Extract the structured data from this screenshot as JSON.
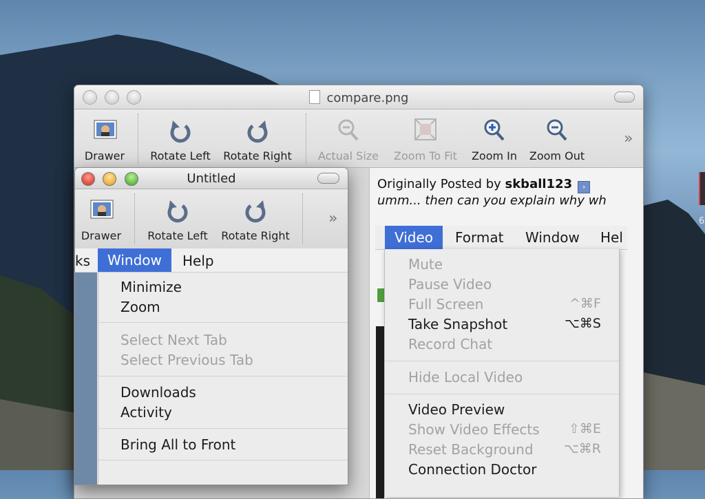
{
  "back_window": {
    "title": "compare.png",
    "toolbar": {
      "drawer": "Drawer",
      "rotate_left": "Rotate Left",
      "rotate_right": "Rotate Right",
      "actual_size": "Actual Size",
      "zoom_to_fit": "Zoom To Fit",
      "zoom_in": "Zoom In",
      "zoom_out": "Zoom Out",
      "overflow": "»"
    },
    "post": {
      "prefix": "Originally Posted by ",
      "author": "skball123",
      "text": "umm... then can you explain why wh"
    },
    "menubar": [
      "Video",
      "Format",
      "Window",
      "Hel"
    ],
    "video_menu": [
      {
        "label": "Mute",
        "shortcut": "",
        "disabled": true
      },
      {
        "label": "Pause Video",
        "shortcut": "",
        "disabled": true
      },
      {
        "label": "Full Screen",
        "shortcut": "^⌘F",
        "disabled": true
      },
      {
        "label": "Take Snapshot",
        "shortcut": "⌥⌘S",
        "disabled": false
      },
      {
        "label": "Record Chat",
        "shortcut": "",
        "disabled": true
      },
      {
        "label": "Hide Local Video",
        "shortcut": "",
        "disabled": true
      },
      {
        "label": "Video Preview",
        "shortcut": "",
        "disabled": false
      },
      {
        "label": "Show Video Effects",
        "shortcut": "⇧⌘E",
        "disabled": true
      },
      {
        "label": "Reset Background",
        "shortcut": "⌥⌘R",
        "disabled": true
      },
      {
        "label": "Connection Doctor",
        "shortcut": "",
        "disabled": false
      }
    ]
  },
  "front_window": {
    "title": "Untitled",
    "toolbar": {
      "drawer": "Drawer",
      "rotate_left": "Rotate Left",
      "rotate_right": "Rotate Right",
      "overflow": "»"
    },
    "menubar": [
      "ks",
      "Window",
      "Help"
    ],
    "window_menu": [
      {
        "label": "Minimize",
        "disabled": false
      },
      {
        "label": "Zoom",
        "disabled": false
      },
      {
        "label": "Select Next Tab",
        "disabled": true
      },
      {
        "label": "Select Previous Tab",
        "disabled": true
      },
      {
        "label": "Downloads",
        "disabled": false
      },
      {
        "label": "Activity",
        "disabled": false
      },
      {
        "label": "Bring All to Front",
        "disabled": false
      }
    ]
  },
  "desktop": {
    "icon_label": "6"
  },
  "colors": {
    "menu_highlight": "#3f6fd6",
    "disabled_text": "#a2a2a2"
  }
}
